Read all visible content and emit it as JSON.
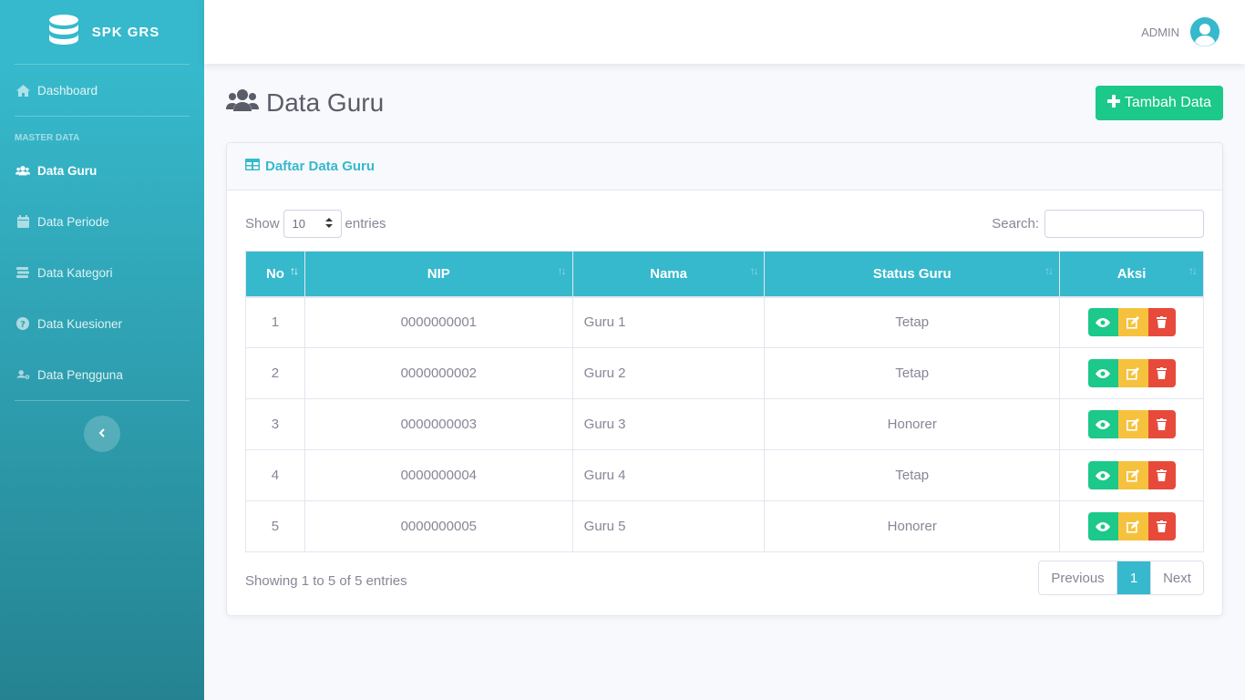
{
  "sidebar": {
    "brand": "SPK GRS",
    "dashboard": "Dashboard",
    "heading": "MASTER DATA",
    "items": [
      {
        "label": "Data Guru"
      },
      {
        "label": "Data Periode"
      },
      {
        "label": "Data Kategori"
      },
      {
        "label": "Data Kuesioner"
      },
      {
        "label": "Data Pengguna"
      }
    ]
  },
  "topbar": {
    "user": "ADMIN"
  },
  "page": {
    "title": "Data Guru",
    "add_button": "Tambah Data"
  },
  "card": {
    "title": "Daftar Data Guru"
  },
  "controls": {
    "show": "Show",
    "length_value": "10",
    "entries": "entries",
    "search_label": "Search:"
  },
  "table": {
    "headers": [
      "No",
      "NIP",
      "Nama",
      "Status Guru",
      "Aksi"
    ],
    "rows": [
      {
        "no": "1",
        "nip": "0000000001",
        "nama": "Guru 1",
        "status": "Tetap"
      },
      {
        "no": "2",
        "nip": "0000000002",
        "nama": "Guru 2",
        "status": "Tetap"
      },
      {
        "no": "3",
        "nip": "0000000003",
        "nama": "Guru 3",
        "status": "Honorer"
      },
      {
        "no": "4",
        "nip": "0000000004",
        "nama": "Guru 4",
        "status": "Tetap"
      },
      {
        "no": "5",
        "nip": "0000000005",
        "nama": "Guru 5",
        "status": "Honorer"
      }
    ]
  },
  "footer": {
    "info": "Showing 1 to 5 of 5 entries",
    "previous": "Previous",
    "page": "1",
    "next": "Next"
  },
  "colors": {
    "primary": "#36b9cc",
    "success": "#1cc88a",
    "warning": "#f6c23e",
    "danger": "#e74a3b"
  }
}
